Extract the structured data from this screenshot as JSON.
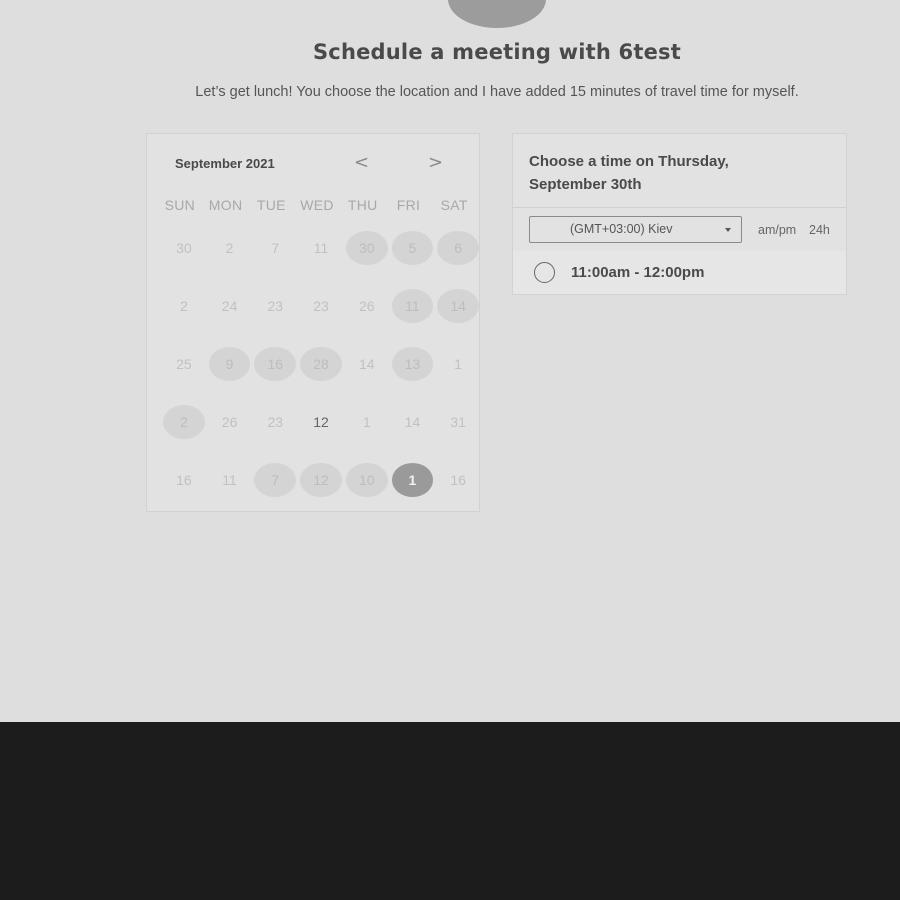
{
  "header": {
    "title": "Schedule a meeting with 6test",
    "subtitle": "Let’s get lunch! You choose the location and I have added 15 minutes of travel time for myself."
  },
  "calendar": {
    "month_label": "September 2021",
    "prev_label": "<",
    "next_label": ">",
    "weekdays": [
      "SUN",
      "MON",
      "TUE",
      "WED",
      "THU",
      "FRI",
      "SAT"
    ],
    "weeks": [
      [
        {
          "label": "30",
          "state": "plain"
        },
        {
          "label": "2",
          "state": "plain"
        },
        {
          "label": "7",
          "state": "plain"
        },
        {
          "label": "11",
          "state": "plain"
        },
        {
          "label": "30",
          "state": "available"
        },
        {
          "label": "5",
          "state": "available"
        },
        {
          "label": "6",
          "state": "available"
        }
      ],
      [
        {
          "label": "2",
          "state": "plain"
        },
        {
          "label": "24",
          "state": "plain"
        },
        {
          "label": "23",
          "state": "plain"
        },
        {
          "label": "23",
          "state": "plain"
        },
        {
          "label": "26",
          "state": "plain"
        },
        {
          "label": "11",
          "state": "available"
        },
        {
          "label": "14",
          "state": "available"
        }
      ],
      [
        {
          "label": "25",
          "state": "plain"
        },
        {
          "label": "9",
          "state": "available"
        },
        {
          "label": "16",
          "state": "available"
        },
        {
          "label": "28",
          "state": "available"
        },
        {
          "label": "14",
          "state": "plain"
        },
        {
          "label": "13",
          "state": "available"
        },
        {
          "label": "1",
          "state": "plain"
        }
      ],
      [
        {
          "label": "2",
          "state": "available"
        },
        {
          "label": "26",
          "state": "plain"
        },
        {
          "label": "23",
          "state": "plain"
        },
        {
          "label": "12",
          "state": "strong"
        },
        {
          "label": "1",
          "state": "plain"
        },
        {
          "label": "14",
          "state": "plain"
        },
        {
          "label": "31",
          "state": "plain"
        }
      ],
      [
        {
          "label": "16",
          "state": "plain"
        },
        {
          "label": "11",
          "state": "plain"
        },
        {
          "label": "7",
          "state": "available"
        },
        {
          "label": "12",
          "state": "available"
        },
        {
          "label": "10",
          "state": "available"
        },
        {
          "label": "1",
          "state": "selected"
        },
        {
          "label": "16",
          "state": "plain"
        }
      ]
    ]
  },
  "times": {
    "heading": "Choose a time on Thursday, September 30th",
    "timezone": "(GMT+03:00) Kiev",
    "format_ampm": "am/pm",
    "format_24h": "24h",
    "slots": [
      {
        "label": "11:00am - 12:00pm",
        "selected": false
      }
    ]
  },
  "colors": {
    "page_background": "#dedede",
    "footer_background": "#1c1c1c",
    "selected_day": "#9a9a9a",
    "available_day": "#d4d4d4"
  },
  "icons": {
    "prev": "chevron-left-icon",
    "next": "chevron-right-icon",
    "timezone_dropdown": "caret-down-icon",
    "slot_radio": "radio-unchecked-icon"
  }
}
